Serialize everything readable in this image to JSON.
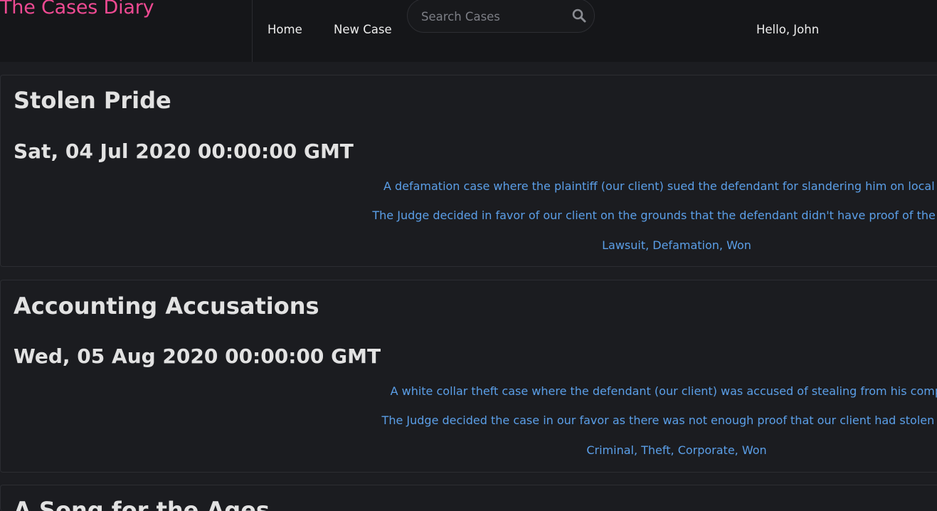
{
  "navbar": {
    "brand": "The Cases Diary",
    "links": {
      "home": "Home",
      "new_case": "New Case"
    },
    "search": {
      "placeholder": "Search Cases",
      "value": ""
    },
    "greeting": "Hello, John"
  },
  "cases": [
    {
      "title": "Stolen Pride",
      "date": "Sat, 04 Jul 2020 00:00:00 GMT",
      "description": "A defamation case where the plaintiff (our client) sued the defendant for slandering him on local televi",
      "outcome": "The Judge decided in favor of our client on the grounds that the defendant didn't have proof of the alleged",
      "tags": "Lawsuit, Defamation, Won"
    },
    {
      "title": "Accounting Accusations",
      "date": "Wed, 05 Aug 2020 00:00:00 GMT",
      "description": "A white collar theft case where the defendant (our client) was accused of stealing from his company",
      "outcome": "The Judge decided the case in our favor as there was not enough proof that our client had stolen the fu",
      "tags": "Criminal, Theft, Corporate, Won"
    },
    {
      "title": "A Song for the Ages"
    }
  ],
  "colors": {
    "brand": "#ee4a92",
    "link_text": "#5b9fe8",
    "background": "#1c1d21",
    "navbar": "#151619"
  },
  "icons": {
    "search": "search-icon"
  }
}
